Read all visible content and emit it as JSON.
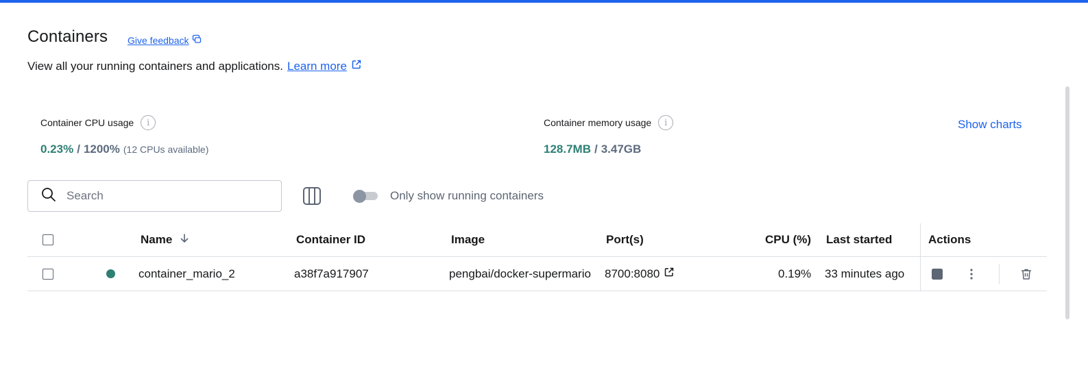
{
  "header": {
    "title": "Containers",
    "feedback_link": "Give feedback",
    "subtitle": "View all your running containers and applications.",
    "learn_more": "Learn more"
  },
  "stats": {
    "cpu": {
      "label": "Container CPU usage",
      "used": "0.23%",
      "separator": "/",
      "total": "1200%",
      "note": "(12 CPUs available)"
    },
    "memory": {
      "label": "Container memory usage",
      "used": "128.7MB",
      "separator": "/",
      "total": "3.47GB"
    },
    "show_charts": "Show charts"
  },
  "toolbar": {
    "search_placeholder": "Search",
    "toggle_label": "Only show running containers",
    "toggle_on": false
  },
  "table": {
    "columns": {
      "name": "Name",
      "container_id": "Container ID",
      "image": "Image",
      "ports": "Port(s)",
      "cpu": "CPU (%)",
      "last_started": "Last started",
      "actions": "Actions"
    },
    "rows": [
      {
        "status": "running",
        "name": "container_mario_2",
        "container_id": "a38f7a917907",
        "image": "pengbai/docker-supermario",
        "ports": "8700:8080",
        "cpu": "0.19%",
        "last_started": "33 minutes ago"
      }
    ]
  },
  "colors": {
    "accent": "#1d63ed",
    "running": "#2e7f74",
    "muted": "#5d6b7e"
  }
}
